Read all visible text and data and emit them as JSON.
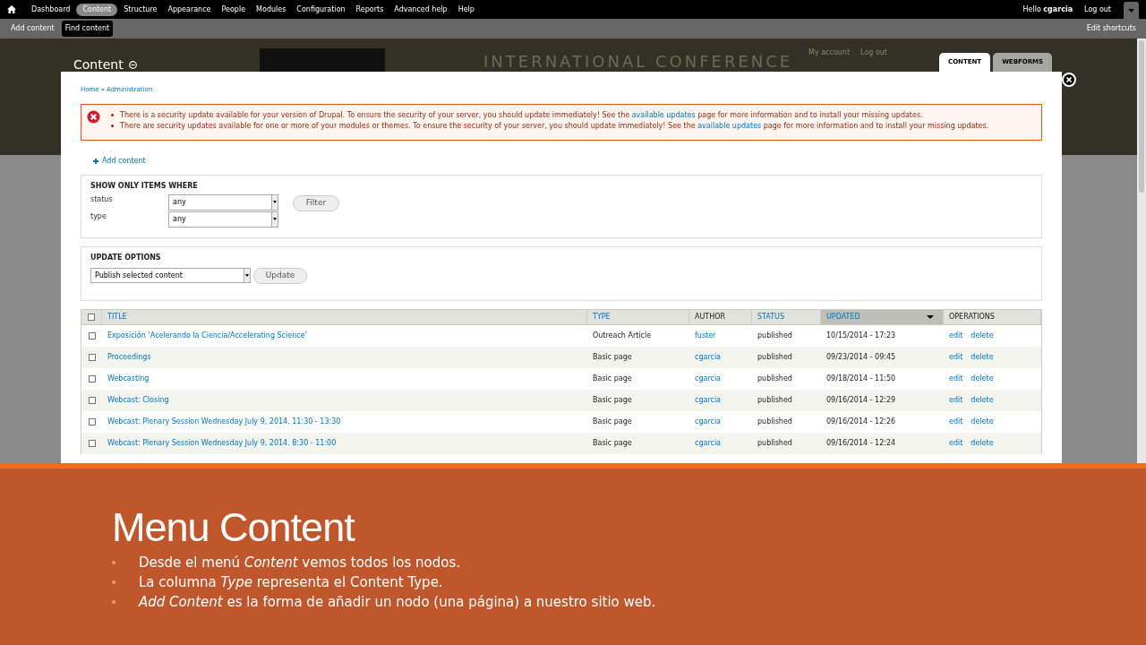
{
  "toolbar": {
    "menu": [
      {
        "label": "Dashboard",
        "selected": false
      },
      {
        "label": "Content",
        "selected": true
      },
      {
        "label": "Structure",
        "selected": false
      },
      {
        "label": "Appearance",
        "selected": false
      },
      {
        "label": "People",
        "selected": false
      },
      {
        "label": "Modules",
        "selected": false
      },
      {
        "label": "Configuration",
        "selected": false
      },
      {
        "label": "Reports",
        "selected": false
      },
      {
        "label": "Advanced help",
        "selected": false
      },
      {
        "label": "Help",
        "selected": false
      }
    ],
    "greeting": "Hello",
    "username": "cgarcia",
    "logout": "Log out"
  },
  "shortcuts": {
    "items": [
      {
        "label": "Add content",
        "selected": false
      },
      {
        "label": "Find content",
        "selected": true
      }
    ],
    "edit": "Edit shortcuts"
  },
  "header": {
    "title": "Content",
    "links": [
      "My account",
      "Log out"
    ],
    "banner": "INTERNATIONAL CONFERENCE"
  },
  "overlay_tabs": [
    {
      "label": "CONTENT",
      "selected": true
    },
    {
      "label": "WEBFORMS",
      "selected": false
    }
  ],
  "breadcrumb": [
    "Home",
    "Administration"
  ],
  "breadcrumb_separator": "»",
  "messages": [
    {
      "before": "There is a security update available for your version of Drupal. To ensure the security of your server, you should update immediately! See the",
      "link": "available updates",
      "after": "page for more information and to install your missing updates."
    },
    {
      "before": "There are security updates available for one or more of your modules or themes. To ensure the security of your server, you should update immediately! See the",
      "link": "available updates",
      "after": "page for more information and to install your missing updates."
    }
  ],
  "add_content": "Add content",
  "filter": {
    "title": "SHOW ONLY ITEMS WHERE",
    "fields": [
      {
        "label": "status",
        "value": "any"
      },
      {
        "label": "type",
        "value": "any"
      }
    ],
    "button": "Filter"
  },
  "update_options": {
    "title": "UPDATE OPTIONS",
    "value": "Publish selected content",
    "button": "Update"
  },
  "table": {
    "select_all_checked": false,
    "columns": [
      {
        "label": "TITLE",
        "sortable": true,
        "sorted": false
      },
      {
        "label": "TYPE",
        "sortable": true,
        "sorted": false
      },
      {
        "label": "AUTHOR",
        "sortable": false,
        "sorted": false
      },
      {
        "label": "STATUS",
        "sortable": true,
        "sorted": false
      },
      {
        "label": "UPDATED",
        "sortable": true,
        "sorted": true
      },
      {
        "label": "OPERATIONS",
        "sortable": false,
        "sorted": false
      }
    ],
    "rows": [
      {
        "checked": false,
        "title": "Exposición ‘Acelerando la Ciencia/Accelerating Science’",
        "type": "Outreach Article",
        "author": "fuster",
        "status": "published",
        "updated": "10/15/2014 - 17:23",
        "operations": [
          "edit",
          "delete"
        ]
      },
      {
        "checked": false,
        "title": "Proceedings",
        "type": "Basic page",
        "author": "cgarcia",
        "status": "published",
        "updated": "09/23/2014 - 09:45",
        "operations": [
          "edit",
          "delete"
        ]
      },
      {
        "checked": false,
        "title": "Webcasting",
        "type": "Basic page",
        "author": "cgarcia",
        "status": "published",
        "updated": "09/18/2014 - 11:50",
        "operations": [
          "edit",
          "delete"
        ]
      },
      {
        "checked": false,
        "title": "Webcast: Closing",
        "type": "Basic page",
        "author": "cgarcia",
        "status": "published",
        "updated": "09/16/2014 - 12:29",
        "operations": [
          "edit",
          "delete"
        ]
      },
      {
        "checked": false,
        "title": "Webcast: Plenary Session Wednesday July 9, 2014. 11:30 - 13:30",
        "type": "Basic page",
        "author": "cgarcia",
        "status": "published",
        "updated": "09/16/2014 - 12:26",
        "operations": [
          "edit",
          "delete"
        ]
      },
      {
        "checked": false,
        "title": "Webcast: Plenary Session Wednesday July 9, 2014. 8:30 - 11:00",
        "type": "Basic page",
        "author": "cgarcia",
        "status": "published",
        "updated": "09/16/2014 - 12:24",
        "operations": [
          "edit",
          "delete"
        ]
      }
    ]
  },
  "slide": {
    "title": "Menu Content",
    "bullets": [
      "Desde el menú *Content* vemos todos los nodos.",
      "La columna *Type* representa el Content Type.",
      "*Add Content* es la forma de añadir un nodo (una página) a nuestro sitio web."
    ]
  }
}
